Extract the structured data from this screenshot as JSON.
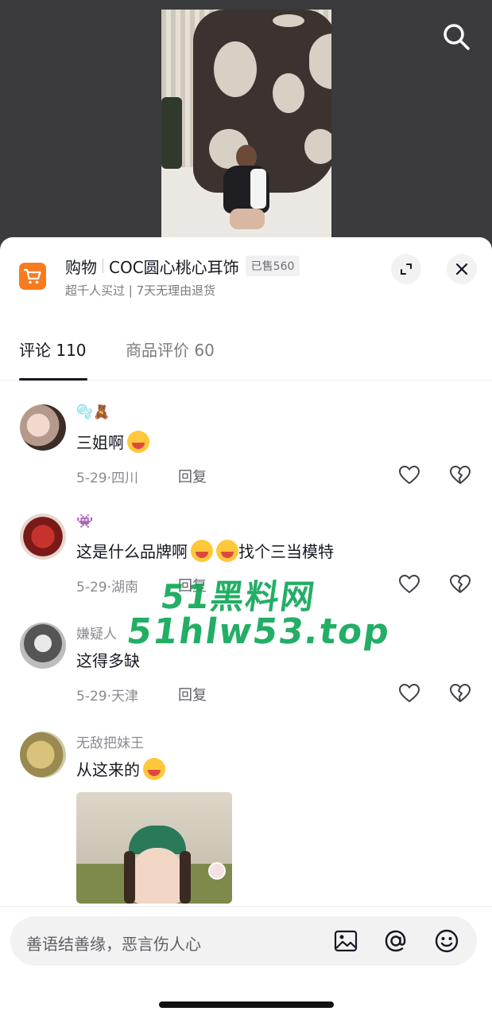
{
  "header": {
    "search_icon": "search-icon"
  },
  "product": {
    "category": "购物",
    "name": "COC圆心桃心耳饰",
    "sold": "已售560",
    "subtitle": "超千人买过 | 7天无理由退货",
    "cart_color": "#fa7b1f"
  },
  "tabs": [
    {
      "label": "评论 110",
      "active": true
    },
    {
      "label": "商品评价 60",
      "active": false
    }
  ],
  "comments": [
    {
      "username": "🫧🧸",
      "text": "三姐啊",
      "emoji": "laugh-cry",
      "date": "5-29",
      "location": "四川",
      "reply": "回复"
    },
    {
      "username": "👾",
      "text": "这是什么品牌啊",
      "text2": "找个三当模特",
      "date": "5-29",
      "location": "湖南",
      "reply": "回复"
    },
    {
      "username": "嫌疑人",
      "text": "这得多缺",
      "date": "5-29",
      "location": "天津",
      "reply": "回复"
    },
    {
      "username": "无敌把妹王",
      "text": "从这来的",
      "emoji": "crying"
    }
  ],
  "watermark": {
    "line1": "51黑料网",
    "line2": "51hlw53.top",
    "color": "#11a85a"
  },
  "input": {
    "placeholder": "善语结善缘，恶言伤人心"
  }
}
